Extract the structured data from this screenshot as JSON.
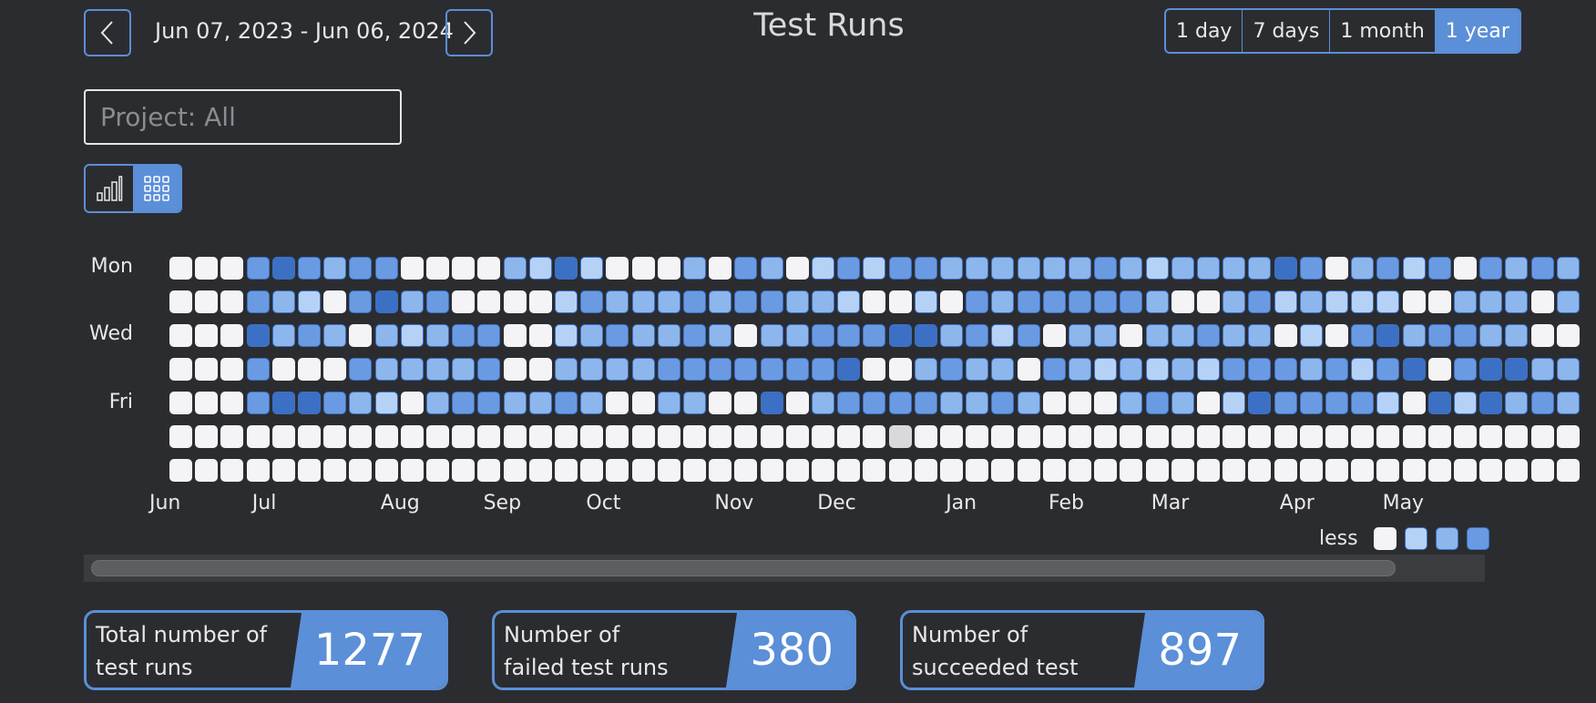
{
  "header": {
    "title": "Test Runs",
    "date_range": "Jun 07, 2023 - Jun 06, 2024",
    "periods": [
      {
        "label": "1 day",
        "active": false
      },
      {
        "label": "7 days",
        "active": false
      },
      {
        "label": "1 month",
        "active": false
      },
      {
        "label": "1 year",
        "active": true
      }
    ]
  },
  "filter": {
    "project_placeholder": "Project: All"
  },
  "view_toggle": {
    "active": "heatmap",
    "options": [
      "bar-chart",
      "heatmap"
    ]
  },
  "heatmap": {
    "day_labels": [
      "Mon",
      "",
      "Wed",
      "",
      "Fri",
      "",
      ""
    ],
    "month_labels": [
      "Jun",
      "Jul",
      "Aug",
      "Sep",
      "Oct",
      "Nov",
      "Dec",
      "Jan",
      "Feb",
      "Mar",
      "Apr",
      "May"
    ],
    "month_start_weeks": [
      0,
      4,
      9,
      13,
      17,
      22,
      26,
      31,
      35,
      39,
      44,
      48
    ],
    "levels": [
      0,
      1,
      2,
      3,
      4
    ],
    "rows": [
      "0003432330000214100020320131332222223212222430231303232",
      "0003210342300001322232332210010323333320023121110022202",
      "0004232021233001232232022333442313022022322010342332200",
      "0003000322223002222333333340023220321212133323134034422",
      "0003443210233223200220040233332232000232014333310414232",
      "0000000000000000000000000000000000000000000000000000000",
      "0000000000000000000000000000000000000000000000000000000"
    ],
    "highlight": {
      "row": 5,
      "week": 28
    },
    "legend_label": "less",
    "colors": {
      "0": "#f4f4f6",
      "1": "#b5d2f6",
      "2": "#8db6ec",
      "3": "#6a9be2",
      "4": "#3b70c4",
      "highlight": "#d9d9dc"
    }
  },
  "stats": [
    {
      "label": "Total number of test runs",
      "value": "1277"
    },
    {
      "label": "Number of failed test runs",
      "value": "380"
    },
    {
      "label": "Number of succeeded test runs",
      "value": "897"
    }
  ],
  "colors": {
    "accent": "#5b8fd8",
    "background": "#2b2c30"
  }
}
